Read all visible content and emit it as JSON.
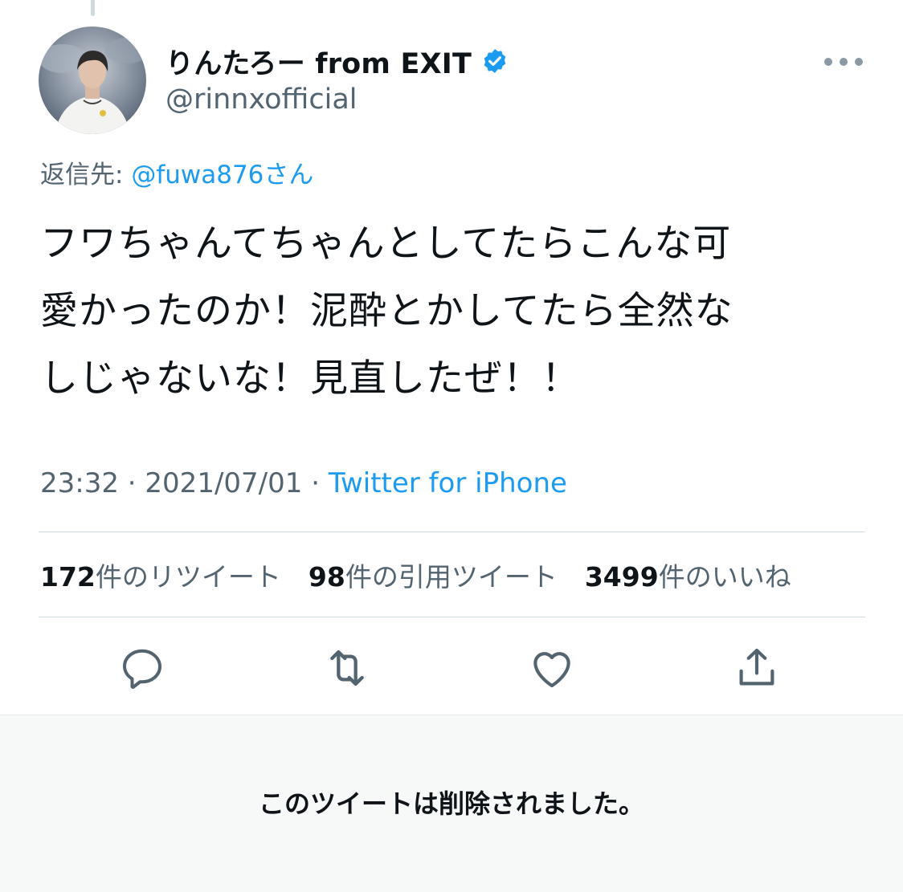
{
  "tweet": {
    "author": {
      "display_name": "りんたろー from EXIT",
      "handle": "@rinnxofficial",
      "verified": true
    },
    "reply_to": {
      "prefix": "返信先: ",
      "mention": "@fuwa876さん"
    },
    "text_lines": [
      "フワちゃんてちゃんとしてたらこんな可",
      "愛かったのか！泥酔とかしてたら全然な",
      "しじゃないな！見直したぜ！！"
    ],
    "time": "23:32",
    "date": "2021/07/01",
    "separator": " · ",
    "source": "Twitter for iPhone",
    "stats": {
      "retweets": {
        "count": "172",
        "label": "件のリツイート"
      },
      "quotes": {
        "count": "98",
        "label": "件の引用ツイート"
      },
      "likes": {
        "count": "3499",
        "label": "件のいいね"
      }
    },
    "actions": {
      "reply_icon": "reply-icon",
      "retweet_icon": "retweet-icon",
      "like_icon": "heart-icon",
      "share_icon": "share-icon"
    }
  },
  "deleted_notice": "このツイートは削除されました。",
  "colors": {
    "accent": "#1d9bf0",
    "text_primary": "#0f1419",
    "text_secondary": "#536471",
    "verified_badge": "#1d9bf0",
    "deleted_bg": "#f7f9f9"
  }
}
